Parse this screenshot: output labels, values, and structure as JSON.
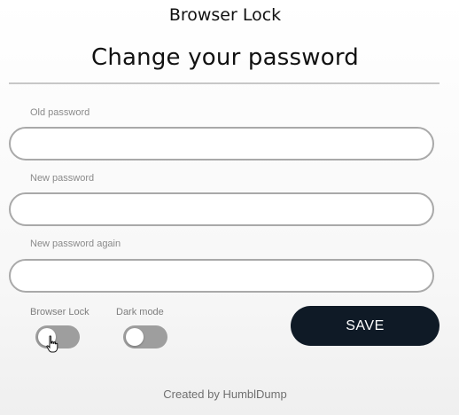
{
  "app": {
    "title": "Browser Lock"
  },
  "page": {
    "heading": "Change your password"
  },
  "form": {
    "old_password": {
      "label": "Old password",
      "value": "",
      "placeholder": ""
    },
    "new_password": {
      "label": "New password",
      "value": "",
      "placeholder": ""
    },
    "new_password_again": {
      "label": "New password again",
      "value": "",
      "placeholder": ""
    }
  },
  "toggles": {
    "browser_lock": {
      "label": "Browser Lock",
      "enabled": false
    },
    "dark_mode": {
      "label": "Dark mode",
      "enabled": false
    }
  },
  "actions": {
    "save_label": "SAVE"
  },
  "footer": {
    "credits": "Created by HumblDump"
  },
  "colors": {
    "button_bg": "#0f1a26",
    "toggle_off": "#9e9e9e",
    "input_border": "#a9a9a9"
  },
  "icons": {
    "cursor": "hand-pointer-icon"
  }
}
